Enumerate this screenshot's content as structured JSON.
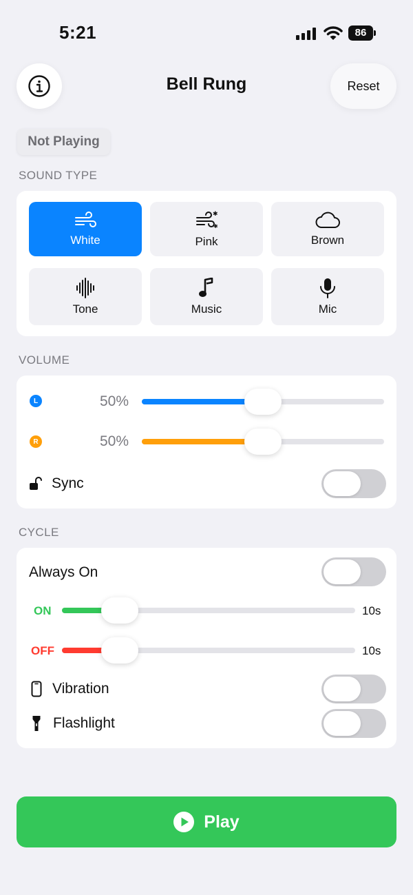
{
  "status_bar": {
    "time": "5:21",
    "battery": "86"
  },
  "header": {
    "title": "Bell Rung",
    "reset_label": "Reset",
    "info_icon": "info-icon"
  },
  "playback_state": "Not Playing",
  "sound_type": {
    "section_label": "SOUND TYPE",
    "selected": "White",
    "options": [
      {
        "label": "White",
        "icon": "wind-icon"
      },
      {
        "label": "Pink",
        "icon": "wind-sparkle-icon"
      },
      {
        "label": "Brown",
        "icon": "cloud-icon"
      },
      {
        "label": "Tone",
        "icon": "waveform-icon"
      },
      {
        "label": "Music",
        "icon": "music-note-icon"
      },
      {
        "label": "Mic",
        "icon": "microphone-icon"
      }
    ]
  },
  "volume": {
    "section_label": "VOLUME",
    "left": {
      "badge": "L",
      "value_text": "50%",
      "value": 0.5,
      "color": "#0a84ff"
    },
    "right": {
      "badge": "R",
      "value_text": "50%",
      "value": 0.5,
      "color": "#ff9f0a"
    },
    "sync_label": "Sync",
    "sync_on": false
  },
  "cycle": {
    "section_label": "CYCLE",
    "always_on_label": "Always On",
    "always_on": false,
    "on": {
      "tag": "ON",
      "value_text": "10s",
      "color": "#34c759"
    },
    "off": {
      "tag": "OFF",
      "value_text": "10s",
      "color": "#ff3b30"
    },
    "vibration_label": "Vibration",
    "vibration_on": false,
    "flashlight_label": "Flashlight",
    "flashlight_on": false
  },
  "play_button": {
    "label": "Play"
  }
}
